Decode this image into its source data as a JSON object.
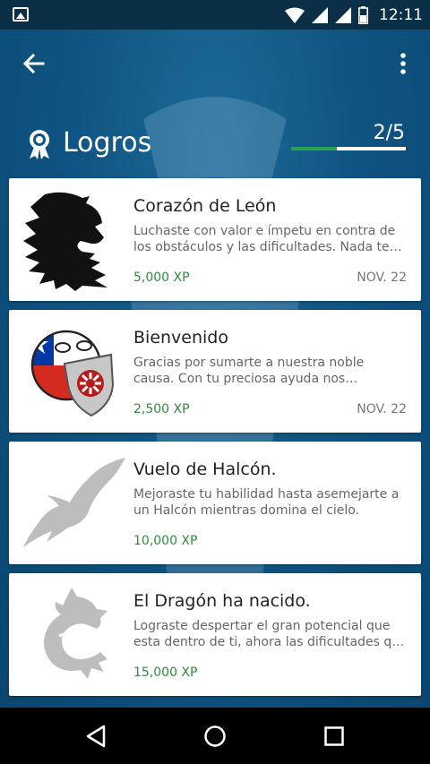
{
  "status_bar": {
    "time": "12:11"
  },
  "header": {
    "title": "Logros",
    "progress_label": "2/5",
    "progress_fraction": 0.4,
    "progress_color": "#2aa34a"
  },
  "achievements": [
    {
      "title": "Corazón de León",
      "desc_line1": "Luchaste con valor e ímpetu en contra de",
      "desc_line2": "los obstáculos y las dificultades. Nada te…",
      "xp": "5,000 XP",
      "date": "NOV. 22",
      "icon": "lion-head-icon"
    },
    {
      "title": "Bienvenido",
      "desc_line1": "Gracias por sumarte a nuestra noble",
      "desc_line2": "causa. Con tu preciosa ayuda nos…",
      "xp": "2,500 XP",
      "date": "NOV. 22",
      "icon": "countryball-icon"
    },
    {
      "title": "Vuelo de Halcón.",
      "desc_line1": "Mejoraste tu habilidad hasta asemejarte a",
      "desc_line2": "un Halcón mientras domina el cielo.",
      "xp": "10,000 XP",
      "date": "",
      "icon": "falcon-icon"
    },
    {
      "title": "El Dragón ha nacido.",
      "desc_line1": "Lograste despertar el gran potencial que",
      "desc_line2": "esta dentro de ti, ahora las dificultades qu…",
      "xp": "15,000 XP",
      "date": "",
      "icon": "dragon-icon"
    }
  ]
}
